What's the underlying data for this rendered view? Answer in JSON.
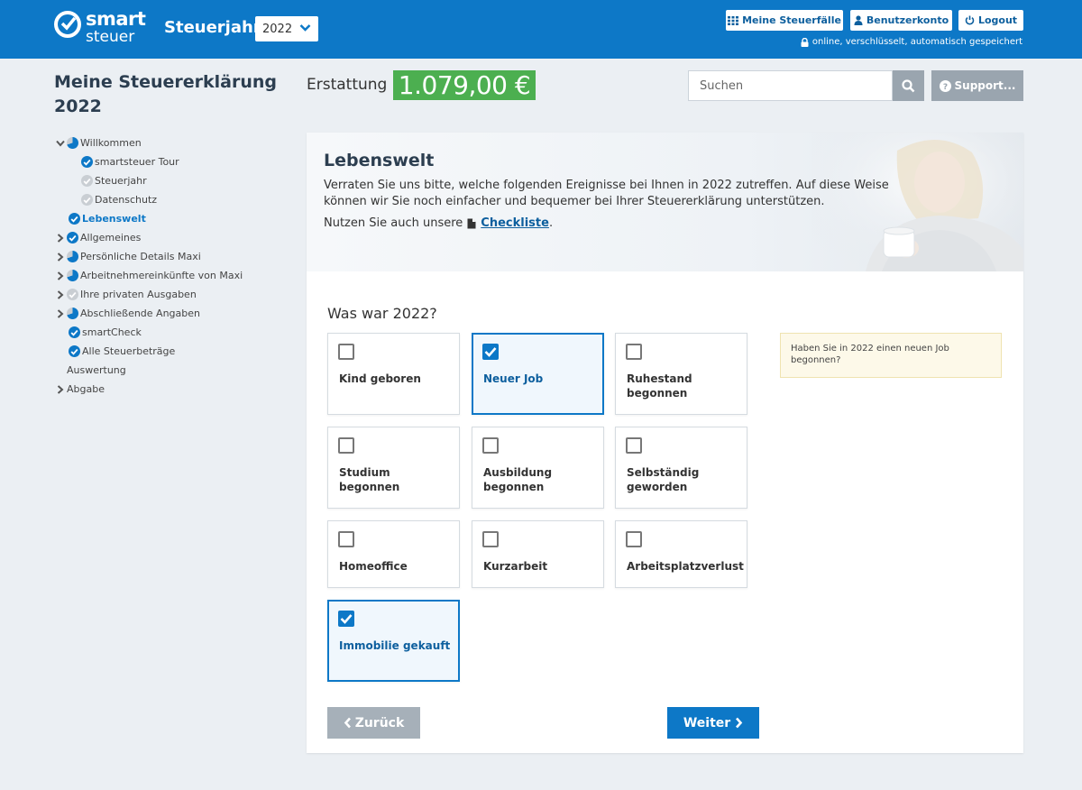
{
  "header": {
    "logo_line1": "smart",
    "logo_line2": "steuer",
    "taxyear_label": "Steuerjahr",
    "taxyear_value": "2022",
    "buttons": {
      "cases": "Meine Steuerfälle",
      "account": "Benutzerkonto",
      "logout": "Logout"
    },
    "secure_text": "online, verschlüsselt, automatisch gespeichert"
  },
  "page": {
    "title": "Meine Steuererklärung 2022",
    "refund_label": "Erstattung",
    "refund_amount": "1.079,00 €"
  },
  "search": {
    "placeholder": "Suchen"
  },
  "support_label": "Support...",
  "sidebar": {
    "items": [
      {
        "label": "Willkommen",
        "status": "partial",
        "chevron": "down"
      },
      {
        "label": "smartsteuer Tour",
        "status": "done"
      },
      {
        "label": "Steuerjahr",
        "status": "todo"
      },
      {
        "label": "Datenschutz",
        "status": "todo"
      },
      {
        "label": "Lebenswelt",
        "status": "done",
        "active": true
      },
      {
        "label": "Allgemeines",
        "status": "done",
        "chevron": "right"
      },
      {
        "label": "Persönliche Details Maxi",
        "status": "partial",
        "chevron": "right"
      },
      {
        "label": "Arbeitnehmereinkünfte von Maxi",
        "status": "partial",
        "chevron": "right"
      },
      {
        "label": "Ihre privaten Ausgaben",
        "status": "todo",
        "chevron": "right"
      },
      {
        "label": "Abschließende Angaben",
        "status": "partial",
        "chevron": "right"
      },
      {
        "label": "smartCheck",
        "status": "done"
      },
      {
        "label": "Alle Steuerbeträge",
        "status": "done"
      },
      {
        "label": "Auswertung",
        "status": "none"
      },
      {
        "label": "Abgabe",
        "status": "none",
        "chevron": "right"
      }
    ]
  },
  "main": {
    "heading": "Lebenswelt",
    "intro": "Verraten Sie uns bitte, welche folgenden Ereignisse bei Ihnen in 2022 zutreffen. Auf diese Weise können wir Sie noch einfacher und bequemer bei Ihrer Steuererklärung unterstützen.",
    "hint_prefix": "Nutzen Sie auch unsere",
    "hint_link": "Checkliste",
    "hint_suffix": ".",
    "question": "Was war 2022?",
    "options": [
      {
        "label": "Kind geboren",
        "checked": false
      },
      {
        "label": "Neuer Job",
        "checked": true
      },
      {
        "label": "Ruhestand begonnen",
        "checked": false
      },
      {
        "label": "Studium begonnen",
        "checked": false
      },
      {
        "label": "Ausbildung begonnen",
        "checked": false
      },
      {
        "label": "Selbständig geworden",
        "checked": false
      },
      {
        "label": "Homeoffice",
        "checked": false
      },
      {
        "label": "Kurzarbeit",
        "checked": false
      },
      {
        "label": "Arbeitsplatzverlust",
        "checked": false
      },
      {
        "label": "Immobilie gekauft",
        "checked": true
      }
    ],
    "help_text": "Haben Sie in 2022 einen neuen Job begonnen?",
    "back_label": "Zurück",
    "next_label": "Weiter"
  },
  "colors": {
    "brand_blue": "#0d78c7",
    "refund_green": "#4caf50",
    "disabled_gray": "#a6b0b9",
    "help_bg": "#fdf9e9"
  }
}
